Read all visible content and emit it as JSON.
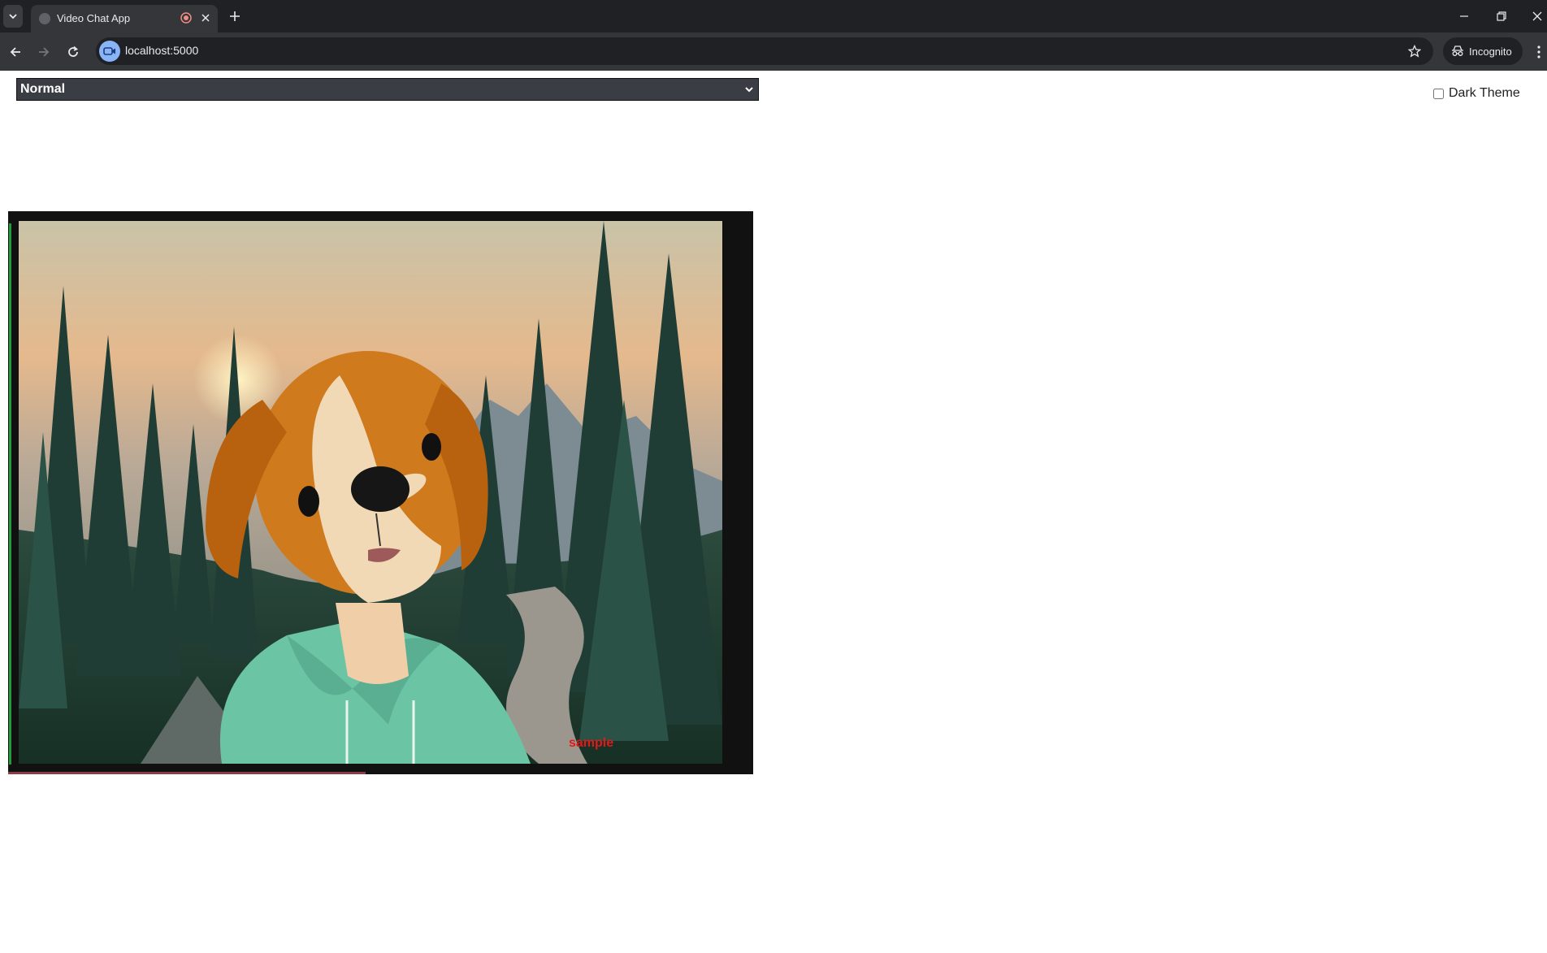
{
  "browser": {
    "tab_title": "Video Chat App",
    "url": "localhost:5000",
    "incognito_label": "Incognito"
  },
  "page": {
    "filter_select": {
      "selected": "Normal"
    },
    "dark_theme": {
      "label": "Dark Theme",
      "checked": false
    },
    "video": {
      "watermark": "sample"
    }
  },
  "icons": {
    "tab_search": "chevron-down-icon",
    "recording": "recording-icon",
    "close_tab": "close-icon",
    "new_tab": "plus-icon",
    "back": "arrow-left-icon",
    "forward": "arrow-right-icon",
    "reload": "reload-icon",
    "site": "video-camera-icon",
    "bookmark": "star-icon",
    "incognito": "incognito-icon",
    "menu": "kebab-menu-icon",
    "minimize": "minimize-icon",
    "restore": "restore-icon",
    "close_window": "close-icon"
  },
  "colors": {
    "chrome_dark": "#202124",
    "chrome_toolbar": "#35363a",
    "select_bg": "#3a3d44",
    "watermark": "#e01919",
    "video_border_left": "#1f9d3a"
  }
}
